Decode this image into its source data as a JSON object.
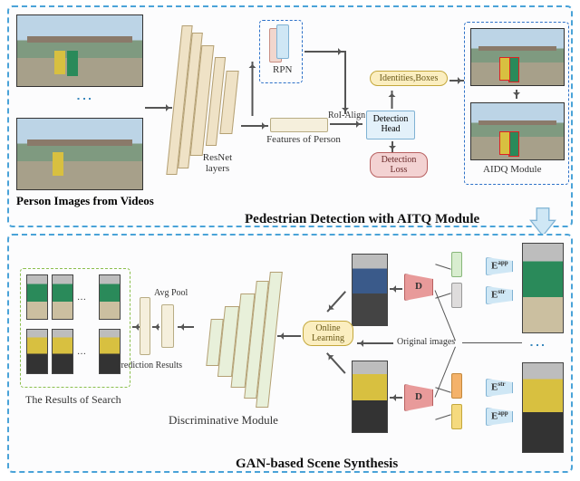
{
  "top": {
    "title": "Pedestrian Detection with AITQ Module",
    "input_caption": "Person Images from Videos",
    "cnn_label": "ResNet\nlayers",
    "rpn_label": "RPN",
    "features_label": "Features of Person",
    "roi_label": "RoI-Align",
    "det_head": "Detection\nHead",
    "identities": "Identities,Boxes",
    "loss": "Detection\nLoss",
    "aidq_label": "AIDQ Module"
  },
  "bottom": {
    "title": "GAN-based Scene Synthesis",
    "results_label": "The Results of Search",
    "disc_label": "Discriminative Module",
    "pred_label": "Prediction Results",
    "avgpool": "Avg Pool",
    "online": "Online\nLearning",
    "d_label": "D",
    "e_app": "Eapp",
    "e_str": "Estr",
    "orig_label": "Original images"
  }
}
